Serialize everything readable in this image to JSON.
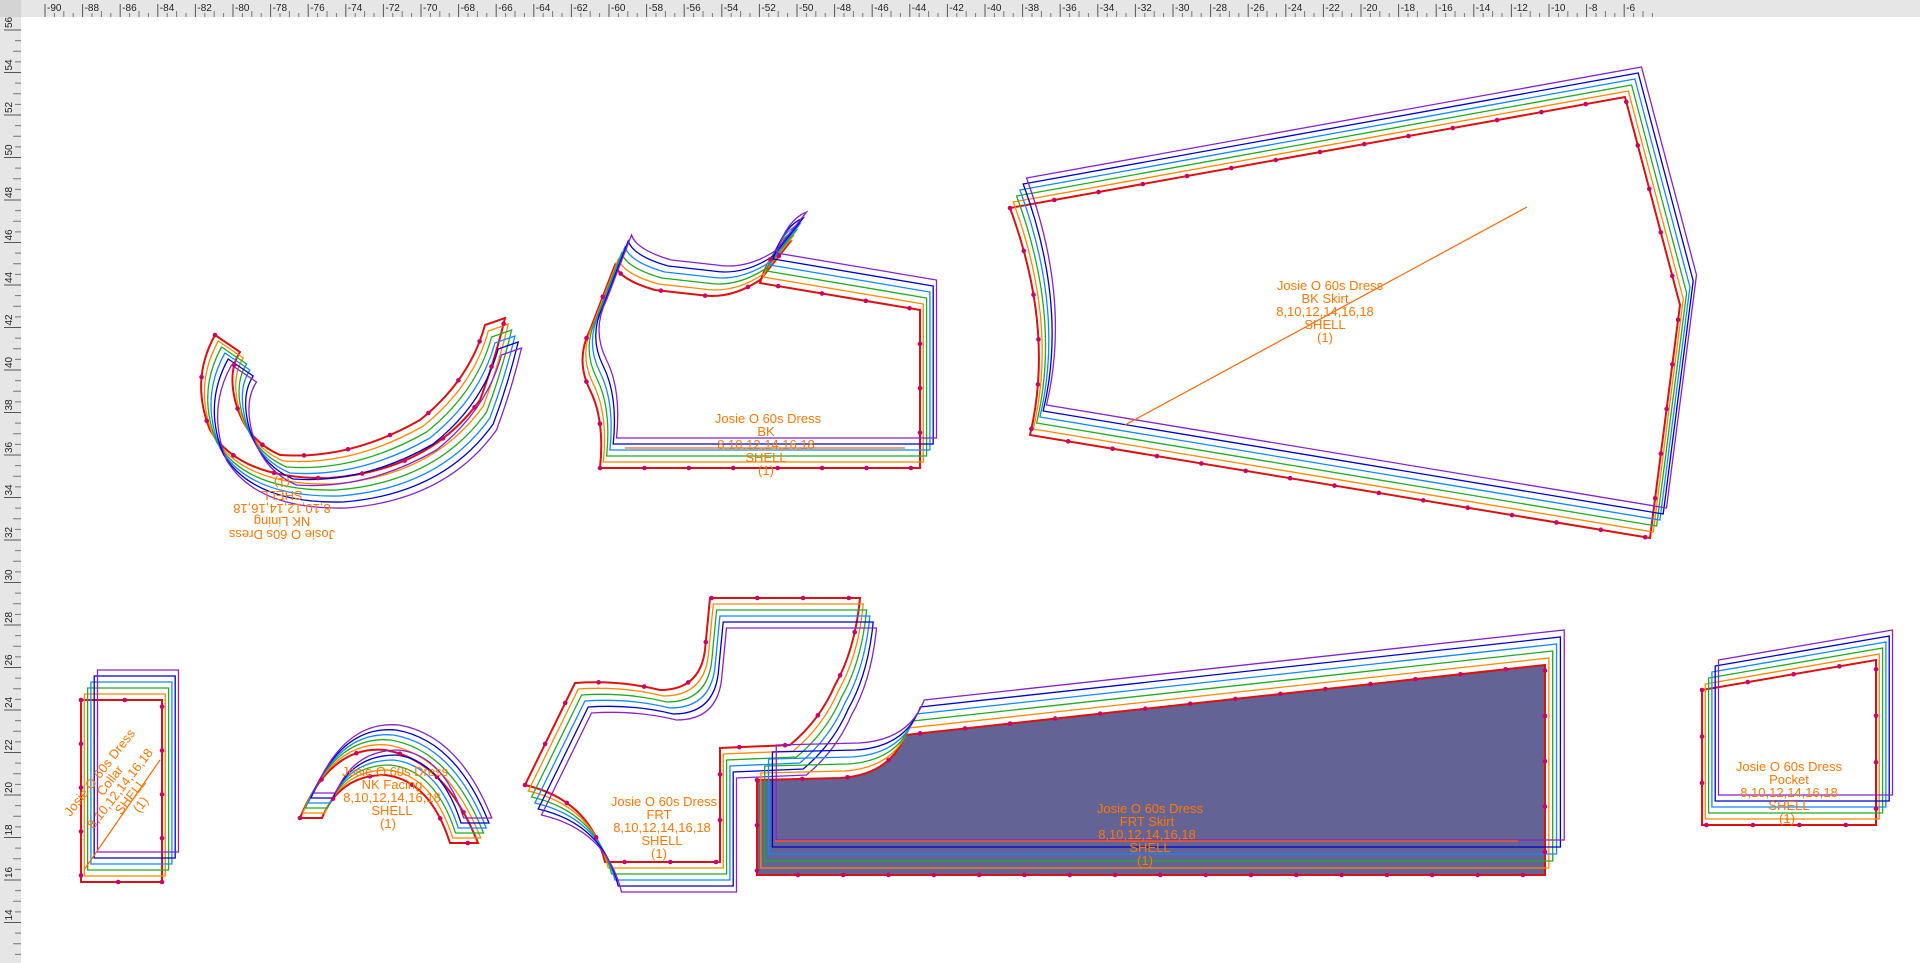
{
  "ruler": {
    "top_labels": [
      "-90",
      "-88",
      "-86",
      "-84",
      "-82",
      "-80",
      "-78",
      "-76",
      "-74",
      "-72",
      "-70",
      "-68",
      "-66",
      "-64",
      "-62",
      "-60",
      "-58",
      "-56",
      "-54",
      "-52",
      "-50",
      "-48",
      "-46",
      "-44",
      "-42",
      "-40",
      "-38",
      "-36",
      "-34",
      "-32",
      "-30",
      "-28",
      "-26",
      "-24",
      "-22",
      "-20",
      "-18",
      "-16",
      "-14",
      "-12",
      "-10",
      "-8",
      "-6"
    ],
    "left_labels": [
      "56",
      "54",
      "52",
      "50",
      "48",
      "46",
      "44",
      "42",
      "40",
      "38",
      "36",
      "34",
      "32",
      "30",
      "28",
      "26",
      "24",
      "22",
      "20",
      "18",
      "16",
      "14"
    ]
  },
  "colors": {
    "grade_lines": [
      "#dd1111",
      "#ff8800",
      "#22aa22",
      "#1188ff",
      "#0000cc",
      "#8822cc"
    ],
    "label": "#ff7700",
    "grain": "#ff6600",
    "points": "#cc0066",
    "selected_fill": "#636495"
  },
  "pieces": {
    "nk_lining": {
      "l1": "Josie O 60s Dress",
      "l2": "NK Lining",
      "l3": "8,10,12,14,16,18",
      "l4": "SHELL",
      "l5": "(1)"
    },
    "bk": {
      "l1": "Josie O 60s Dress",
      "l2": "BK",
      "l3": "8,10,12,14,16,18",
      "l4": "SHELL",
      "l5": "(1)"
    },
    "bk_skirt": {
      "l1": "Josie O 60s Dress",
      "l2": "BK Skirt",
      "l3": "8,10,12,14,16,18",
      "l4": "SHELL",
      "l5": "(1)"
    },
    "collar": {
      "l1": "Josie O 60s Dress",
      "l2": "Collar",
      "l3": "8,10,12,14,16,18",
      "l4": "SHELL",
      "l5": "(1)"
    },
    "nk_facing": {
      "l1": "Josie O 60s Dress",
      "l2": "NK Facing",
      "l3": "8,10,12,14,16,18",
      "l4": "SHELL",
      "l5": "(1)"
    },
    "frt": {
      "l1": "Josie O 60s Dress",
      "l2": "FRT",
      "l3": "8,10,12,14,16,18",
      "l4": "SHELL",
      "l5": "(1)"
    },
    "frt_skirt": {
      "l1": "Josie O 60s Dress",
      "l2": "FRT Skirt",
      "l3": "8,10,12,14,16,18",
      "l4": "SHELL",
      "l5": "(1)"
    },
    "pocket": {
      "l1": "Josie O 60s Dress",
      "l2": "Pocket",
      "l3": "8,10,12,14,16,18",
      "l4": "SHELL",
      "l5": "(1)"
    }
  }
}
